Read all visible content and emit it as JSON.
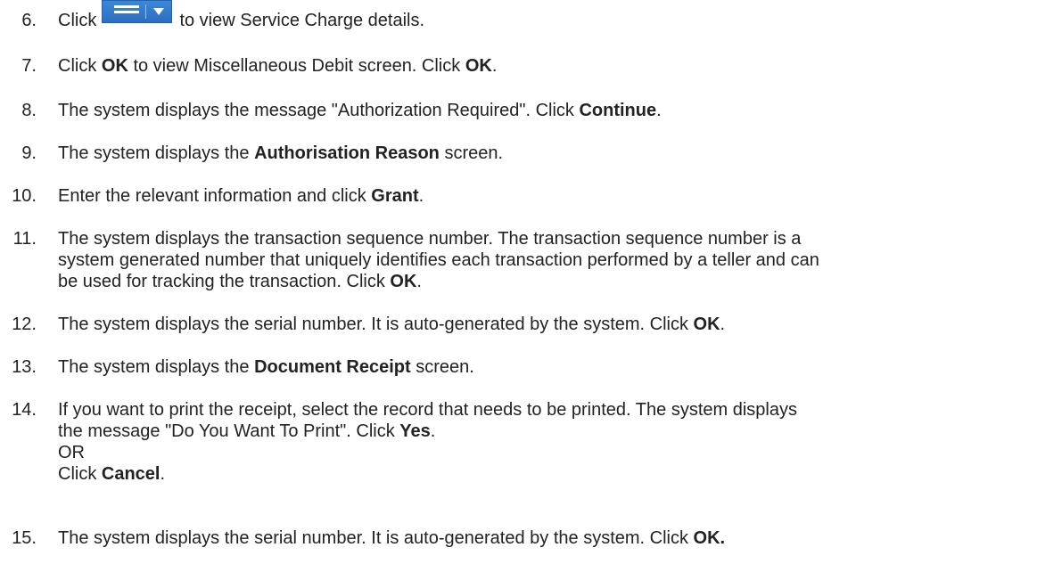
{
  "steps": [
    {
      "num": "6.",
      "lines": [
        {
          "t1": "Click ",
          "icon": "menu-dropdown-icon",
          "t2": " to view Service Charge details."
        }
      ]
    },
    {
      "num": "7.",
      "lines": [
        {
          "t1": "Click ",
          "b1": "OK",
          "t2": " to view Miscellaneous Debit screen. Click ",
          "b2": "OK",
          "t3": "."
        }
      ]
    },
    {
      "num": "8.",
      "lines": [
        {
          "t1": "The system displays the message \"Authorization Required\". Click ",
          "b1": "Continue",
          "t2": "."
        }
      ]
    },
    {
      "num": "9.",
      "lines": [
        {
          "t1": "The system displays the ",
          "b1": "Authorisation Reason",
          "t2": " screen."
        }
      ]
    },
    {
      "num": "10.",
      "lines": [
        {
          "t1": "Enter the relevant information and click ",
          "b1": "Grant",
          "t2": "."
        }
      ]
    },
    {
      "num": "11.",
      "lines": [
        {
          "t1": "The system displays the transaction sequence number. The transaction sequence number is a"
        },
        {
          "t1": "system generated number that uniquely identifies each transaction performed by a teller and can"
        },
        {
          "t1": "be used for tracking the transaction. Click ",
          "b1": "OK",
          "t2": "."
        }
      ]
    },
    {
      "num": "12.",
      "lines": [
        {
          "t1": "The system displays the serial number. It is auto-generated by the system. Click ",
          "b1": "OK",
          "t2": "."
        }
      ]
    },
    {
      "num": "13.",
      "lines": [
        {
          "t1": "The system displays the ",
          "b1": "Document Receipt",
          "t2": " screen."
        }
      ]
    },
    {
      "num": "14.",
      "lines": [
        {
          "t1": "If you want to print the receipt, select the record that needs to be printed. The system displays"
        },
        {
          "t1": "the message \"Do You Want To Print\". Click ",
          "b1": "Yes",
          "t2": "."
        },
        {
          "t1": "OR"
        },
        {
          "t1": "Click ",
          "b1": "Cancel",
          "t2": "."
        }
      ]
    },
    {
      "num": "15.",
      "lines": [
        {
          "t1": "The system displays the serial number. It is auto-generated by the system. Click ",
          "b1": "OK."
        }
      ]
    }
  ]
}
